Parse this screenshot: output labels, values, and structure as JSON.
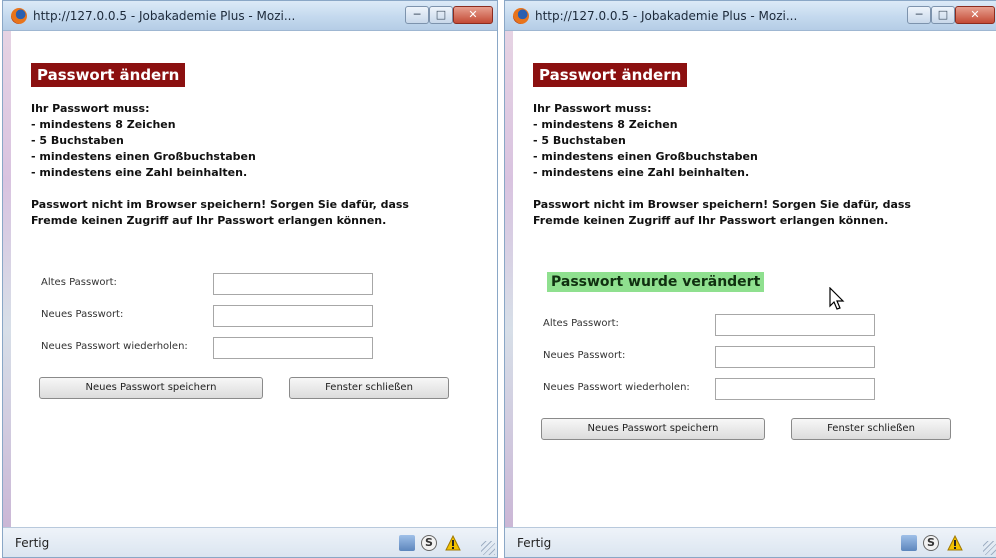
{
  "windows": [
    {
      "title": "http://127.0.0.5 - Jobakademie Plus - Mozi...",
      "heading": "Passwort ändern",
      "rules": [
        "Ihr Passwort muss:",
        "- mindestens 8 Zeichen",
        "- 5 Buchstaben",
        "- mindestens einen Großbuchstaben",
        "- mindestens eine Zahl beinhalten."
      ],
      "warning": "Passwort nicht im Browser speichern! Sorgen Sie dafür, dass Fremde keinen Zugriff auf Ihr Passwort erlangen können.",
      "success": "",
      "form": {
        "old_label": "Altes Passwort:",
        "new_label": "Neues Passwort:",
        "repeat_label": "Neues Passwort wiederholen:",
        "old_value": "",
        "new_value": "",
        "repeat_value": "",
        "save_button": "Neues Passwort speichern",
        "close_button": "Fenster schließen"
      },
      "status": "Fertig"
    },
    {
      "title": "http://127.0.0.5 - Jobakademie Plus - Mozi...",
      "heading": "Passwort ändern",
      "rules": [
        "Ihr Passwort muss:",
        "- mindestens 8 Zeichen",
        "- 5 Buchstaben",
        "- mindestens einen Großbuchstaben",
        "- mindestens eine Zahl beinhalten."
      ],
      "warning": "Passwort nicht im Browser speichern! Sorgen Sie dafür, dass Fremde keinen Zugriff auf Ihr Passwort erlangen können.",
      "success": "Passwort wurde verändert",
      "form": {
        "old_label": "Altes Passwort:",
        "new_label": "Neues Passwort:",
        "repeat_label": "Neues Passwort wiederholen:",
        "old_value": "",
        "new_value": "",
        "repeat_value": "",
        "save_button": "Neues Passwort speichern",
        "close_button": "Fenster schließen"
      },
      "status": "Fertig"
    }
  ],
  "colors": {
    "heading_bg": "#8b1010",
    "success_bg": "#8fe08f",
    "titlebar": "#c4d9ee"
  },
  "icons": {
    "browser": "firefox-icon",
    "minimize": "minimize-icon",
    "maximize": "maximize-icon",
    "close": "close-icon",
    "page": "page-icon",
    "security": "s-icon",
    "warning": "warning-icon"
  }
}
